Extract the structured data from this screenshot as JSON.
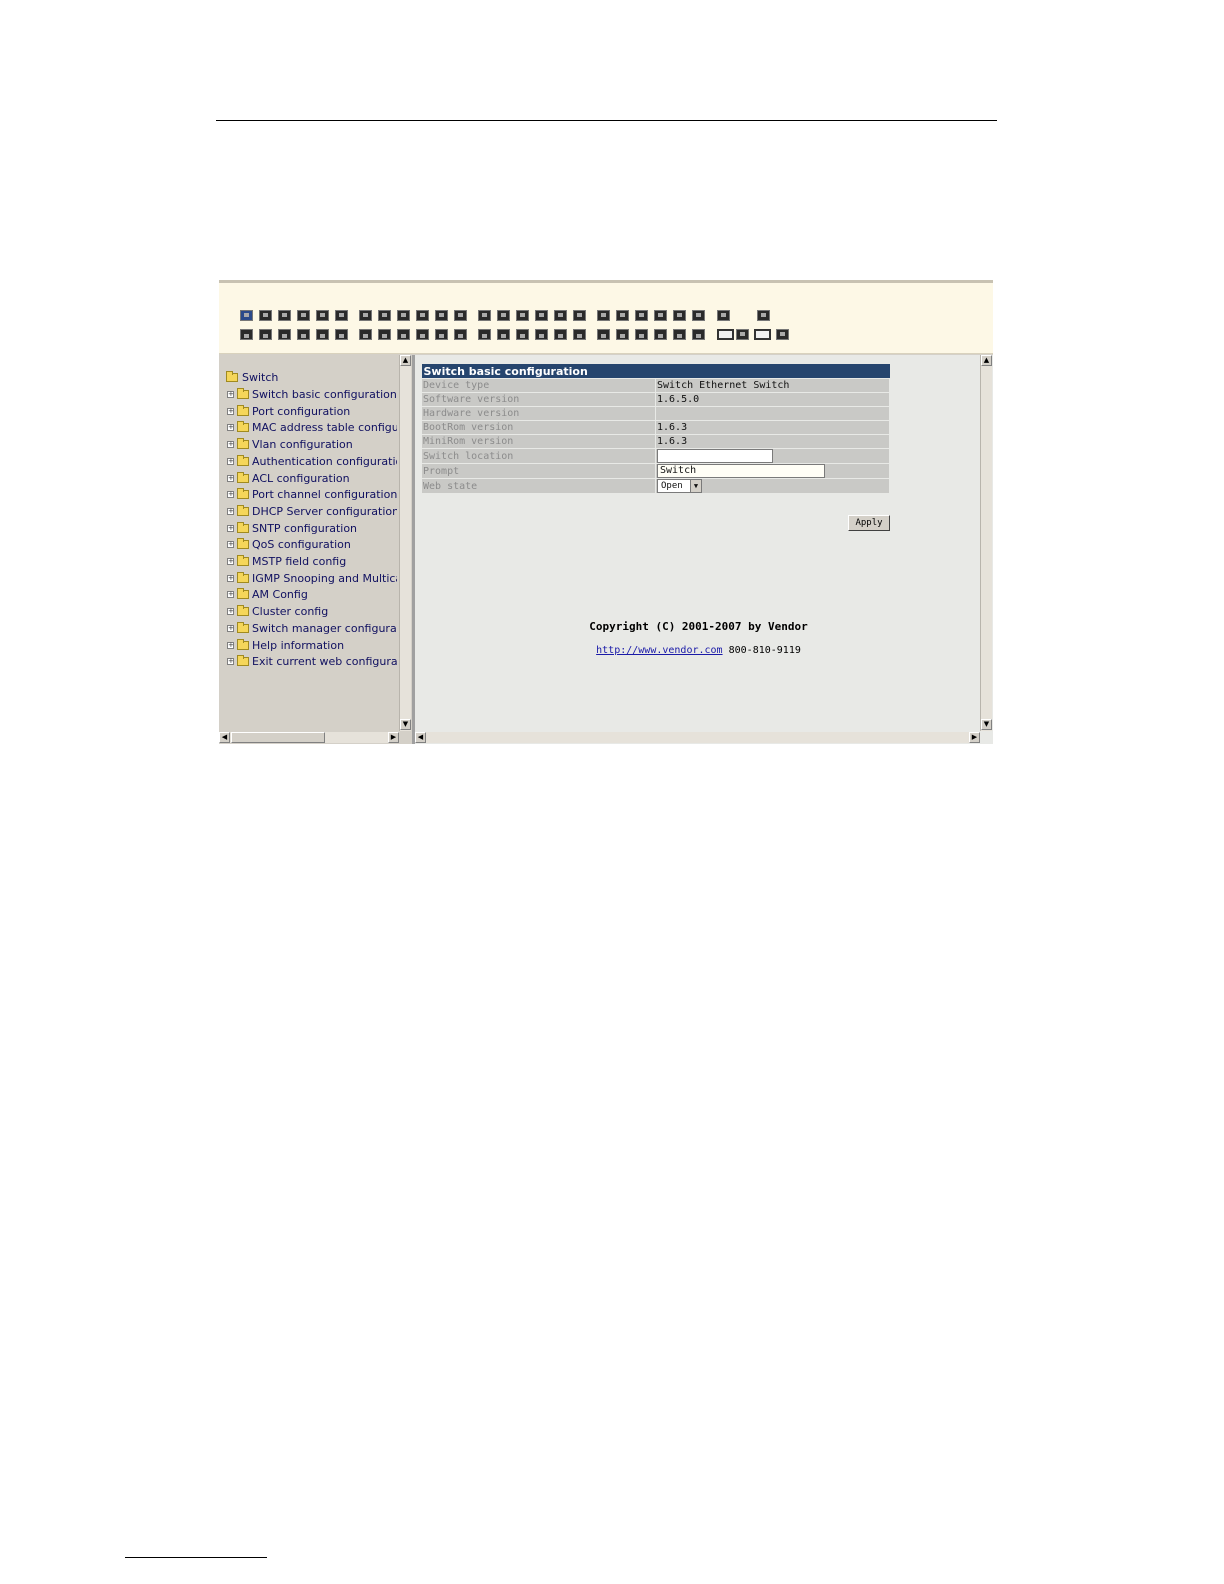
{
  "banner": {
    "top_ports_count": 24,
    "bottom_ports_count": 24,
    "active_port_index": 0
  },
  "tree": {
    "root_label": "Switch",
    "items": [
      {
        "label": "Switch basic configuration"
      },
      {
        "label": "Port configuration"
      },
      {
        "label": "MAC address table configura"
      },
      {
        "label": "Vlan configuration"
      },
      {
        "label": "Authentication configuration"
      },
      {
        "label": "ACL configuration"
      },
      {
        "label": "Port channel configuration"
      },
      {
        "label": "DHCP Server configuration"
      },
      {
        "label": "SNTP configuration"
      },
      {
        "label": "QoS configuration"
      },
      {
        "label": "MSTP field config"
      },
      {
        "label": "IGMP Snooping and Multicast"
      },
      {
        "label": "AM Config"
      },
      {
        "label": "Cluster config"
      },
      {
        "label": "Switch manager configuratio"
      },
      {
        "label": "Help information"
      },
      {
        "label": "Exit current web configuratic"
      }
    ]
  },
  "config": {
    "title": "Switch basic configuration",
    "rows": {
      "device_type": {
        "label": "Device type",
        "value": "Switch Ethernet Switch"
      },
      "software_version": {
        "label": "Software version",
        "value": "1.6.5.0"
      },
      "hardware_version": {
        "label": "Hardware version",
        "value": ""
      },
      "bootrom_version": {
        "label": "BootRom version",
        "value": "1.6.3"
      },
      "minirom_version": {
        "label": "MiniRom version",
        "value": "1.6.3"
      },
      "switch_location": {
        "label": "Switch location",
        "value": ""
      },
      "prompt": {
        "label": "Prompt",
        "value": "Switch"
      },
      "web_state": {
        "label": "Web state",
        "value": "Open"
      }
    },
    "apply_label": "Apply"
  },
  "footer": {
    "copyright": "Copyright (C) 2001-2007 by Vendor",
    "url": "http://www.vendor.com",
    "phone": "800-810-9119"
  }
}
